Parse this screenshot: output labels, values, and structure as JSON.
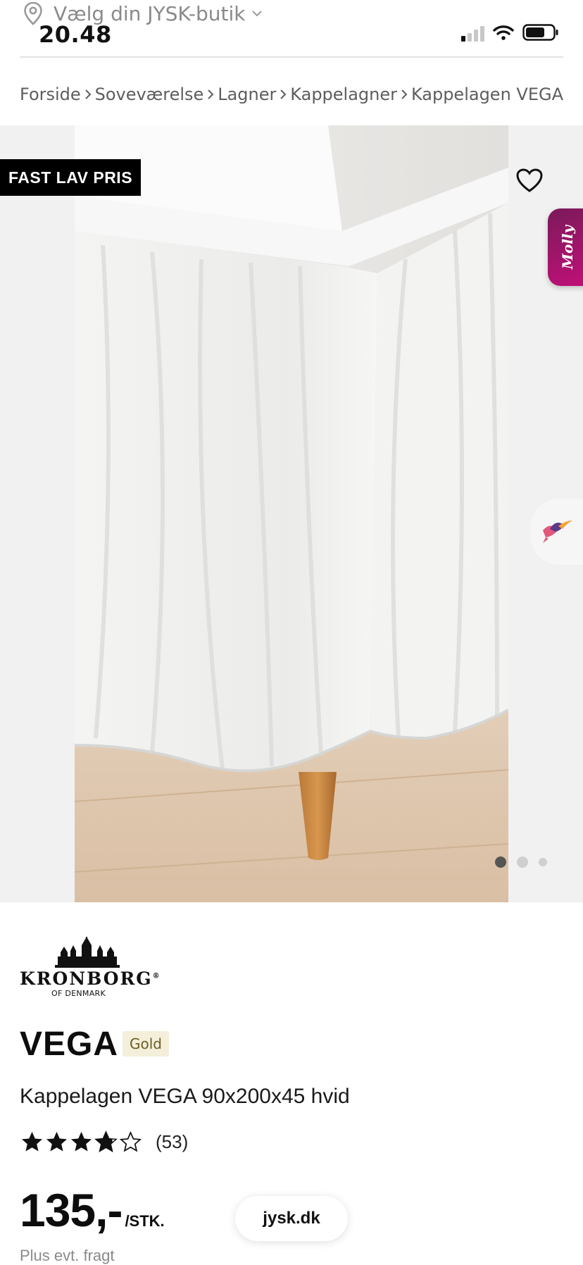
{
  "status_bar": {
    "store_selector_label": "Vælg din JYSK-butik",
    "time": "20.48",
    "icons": [
      "location-pin-icon",
      "chevron-down-icon",
      "cellular-signal-icon",
      "wifi-icon",
      "battery-icon"
    ]
  },
  "breadcrumb": {
    "items": [
      "Forside",
      "Soveværelse",
      "Lagner",
      "Kappelagner",
      "Kappelagen VEGA"
    ]
  },
  "gallery": {
    "badge": "FAST LAV PRIS",
    "badge_bg": "#000000",
    "favorite_icon": "heart-outline-icon",
    "chat_widget_label": "Molly",
    "chat_widget_color": "#b0146f",
    "secondary_widget_icon": "bird-icon",
    "image_count": 3,
    "active_image_index": 0
  },
  "product": {
    "brand": "KRONBORG",
    "brand_registered": "®",
    "brand_sub": "OF DENMARK",
    "name": "VEGA",
    "tier": "Gold",
    "description": "Kappelagen VEGA 90x200x45 hvid",
    "rating": 3.8,
    "rating_max": 5,
    "review_count": "(53)",
    "price": "135,-",
    "price_unit": "/STK.",
    "freight_note": "Plus evt. fragt"
  },
  "browser": {
    "url": "jysk.dk"
  }
}
